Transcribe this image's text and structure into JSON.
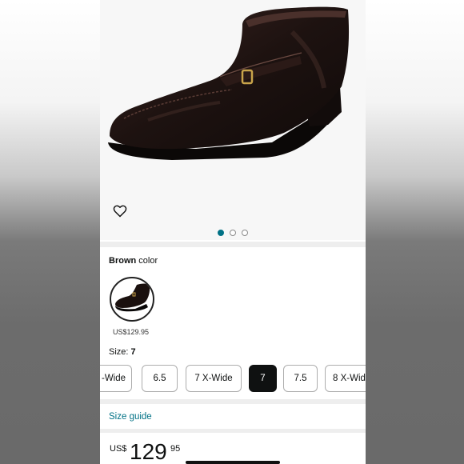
{
  "product": {
    "color_name": "Brown",
    "color_suffix": "color",
    "swatch_price": "US$129.95"
  },
  "carousel": {
    "pages": 3,
    "active_index": 0
  },
  "size": {
    "label": "Size:",
    "value": "7",
    "options": [
      "-Wide",
      "6.5",
      "7 X-Wide",
      "7",
      "7.5",
      "8 X-Wid"
    ],
    "selected_index": 3
  },
  "size_guide_label": "Size guide",
  "price": {
    "currency": "US$",
    "whole": "129",
    "fraction": "95"
  },
  "icons": {
    "favorite": "heart-outline-icon"
  },
  "colors": {
    "link": "#007185",
    "selected_size_bg": "#0f1111",
    "active_dot": "#007185"
  }
}
